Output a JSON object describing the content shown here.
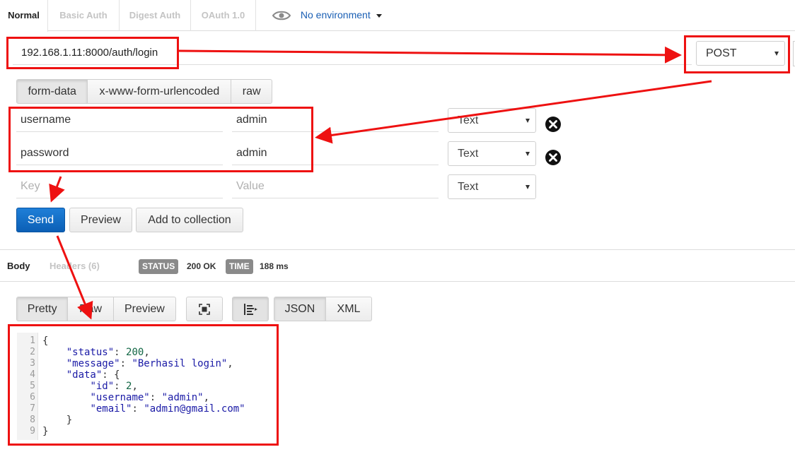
{
  "auth_tabs": [
    "Normal",
    "Basic Auth",
    "Digest Auth",
    "OAuth 1.0"
  ],
  "environment": {
    "label": "No environment",
    "icon": "eye-icon"
  },
  "request": {
    "url": "192.168.1.11:8000/auth/login",
    "method": "POST"
  },
  "body_types": [
    "form-data",
    "x-www-form-urlencoded",
    "raw"
  ],
  "params": [
    {
      "key": "username",
      "value": "admin",
      "type": "Text"
    },
    {
      "key": "password",
      "value": "admin",
      "type": "Text"
    }
  ],
  "new_param": {
    "key_placeholder": "Key",
    "value_placeholder": "Value",
    "type": "Text"
  },
  "actions": {
    "send": "Send",
    "preview": "Preview",
    "add_to_collection": "Add to collection"
  },
  "response_tabs": {
    "body": "Body",
    "headers": "Headers (6)"
  },
  "status": {
    "status_label": "STATUS",
    "status_value": "200 OK",
    "time_label": "TIME",
    "time_value": "188 ms"
  },
  "view_modes": [
    "Pretty",
    "Raw",
    "Preview"
  ],
  "formats": [
    "JSON",
    "XML"
  ],
  "line_numbers": [
    "1",
    "2",
    "3",
    "4",
    "5",
    "6",
    "7",
    "8",
    "9"
  ],
  "response_json": {
    "open_brace": "{",
    "status_key": "\"status\"",
    "status_val": "200",
    "message_key": "\"message\"",
    "message_val": "\"Berhasil login\"",
    "data_key": "\"data\"",
    "data_open": "{",
    "id_key": "\"id\"",
    "id_val": "2",
    "username_key": "\"username\"",
    "username_val": "\"admin\"",
    "email_key": "\"email\"",
    "email_val": "\"admin@gmail.com\"",
    "data_close": "}",
    "close_brace": "}"
  },
  "colors": {
    "primary": "#1f7fd8",
    "annotation": "#ee1111",
    "link": "#1a5fb4"
  }
}
